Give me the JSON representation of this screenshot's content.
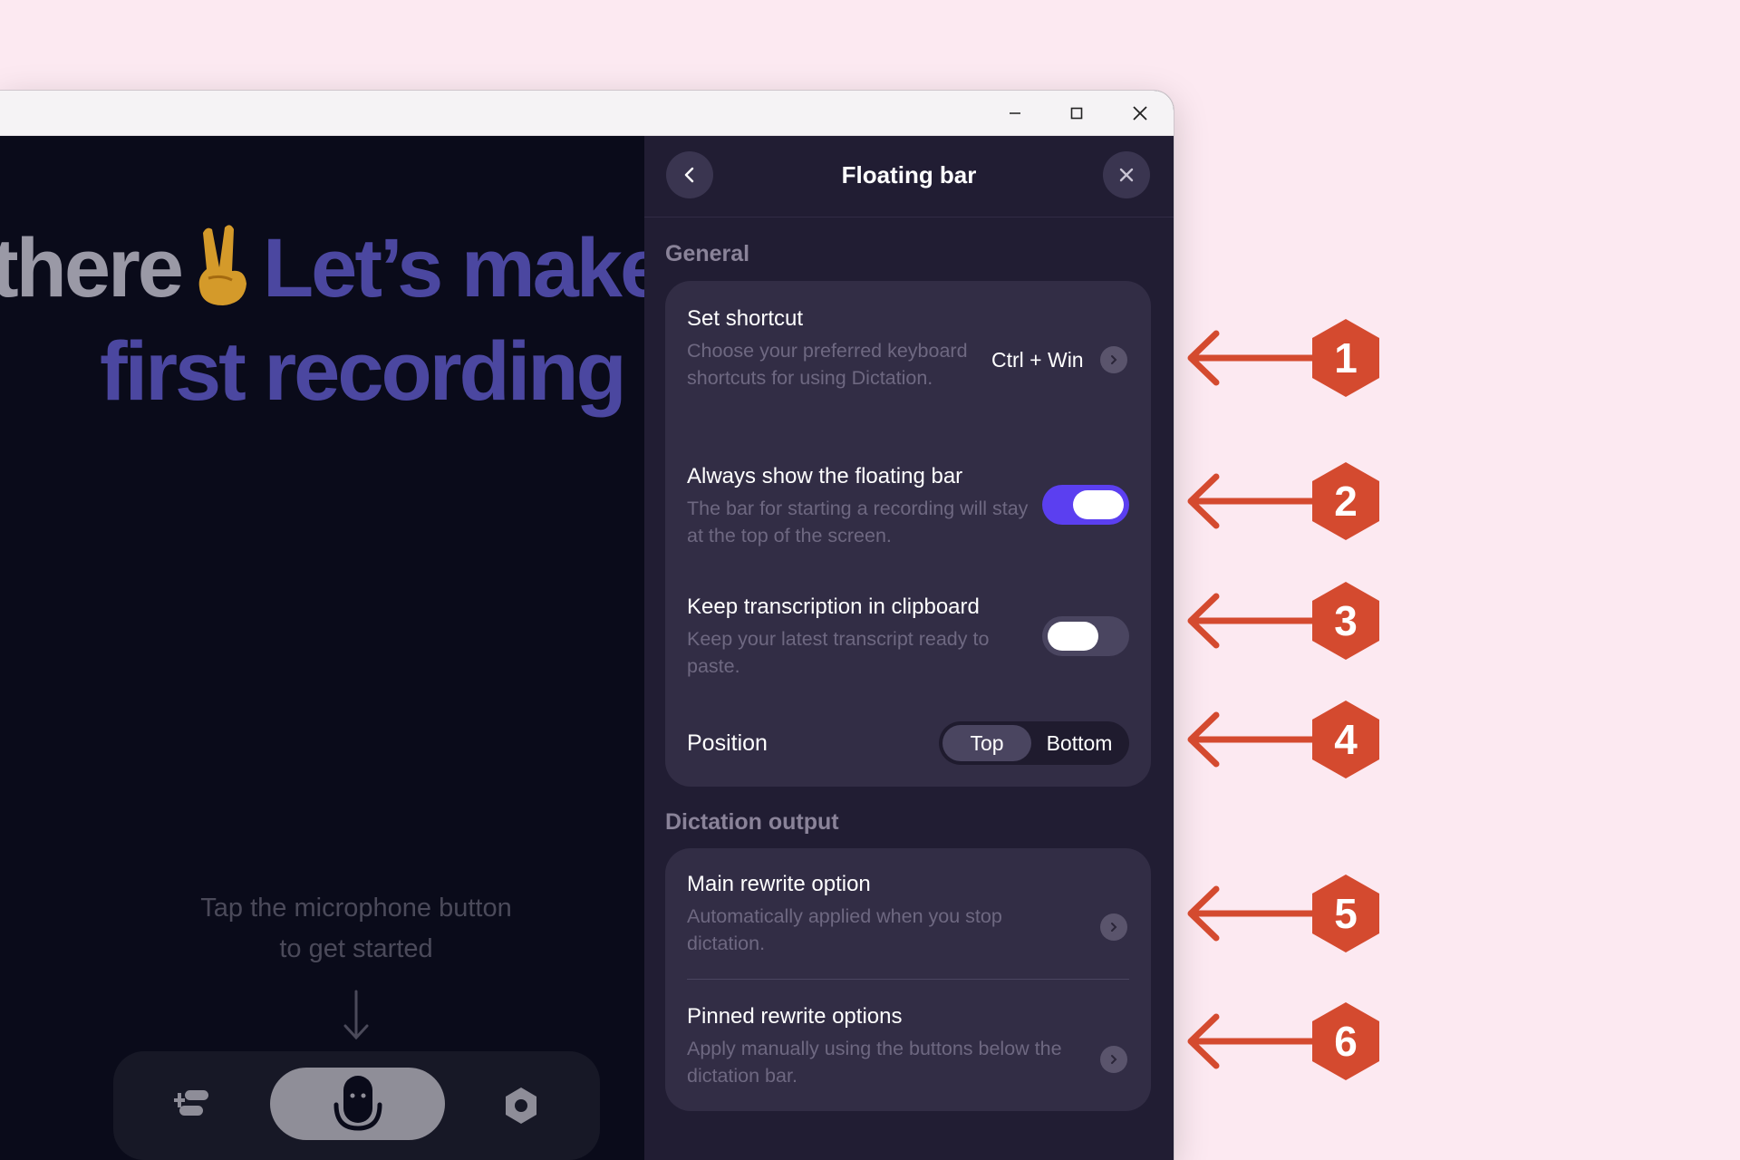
{
  "window": {
    "controls": {
      "minimize": "minimize-icon",
      "maximize": "maximize-icon",
      "close": "close-icon"
    }
  },
  "main": {
    "hero_line1_a": "there",
    "hero_line1_b": "Let’s make",
    "hero_line2": "first recording",
    "tap_line1": "Tap the microphone button",
    "tap_line2": "to get started"
  },
  "panel": {
    "title": "Floating bar",
    "general_label": "General",
    "shortcut": {
      "title": "Set shortcut",
      "desc": "Choose your preferred keyboard shortcuts for using Dictation.",
      "value": "Ctrl + Win"
    },
    "always_show": {
      "title": "Always show the floating bar",
      "desc": "The bar for starting a recording will stay at the top of the screen.",
      "enabled": true
    },
    "clipboard": {
      "title": "Keep transcription in clipboard",
      "desc": "Keep your latest transcript ready to paste.",
      "enabled": false
    },
    "position": {
      "title": "Position",
      "options": [
        "Top",
        "Bottom"
      ],
      "selected": "Top"
    },
    "dictation_label": "Dictation output",
    "main_rewrite": {
      "title": "Main rewrite option",
      "desc": "Automatically applied when you stop dictation."
    },
    "pinned_rewrite": {
      "title": "Pinned rewrite options",
      "desc": "Apply manually using the buttons below the dictation bar."
    }
  },
  "annotations": [
    "1",
    "2",
    "3",
    "4",
    "5",
    "6"
  ],
  "colors": {
    "accent": "#5b3ff0",
    "annotation": "#d44a2f",
    "hero_purple": "#4b47a0",
    "background": "#fce9f1"
  }
}
